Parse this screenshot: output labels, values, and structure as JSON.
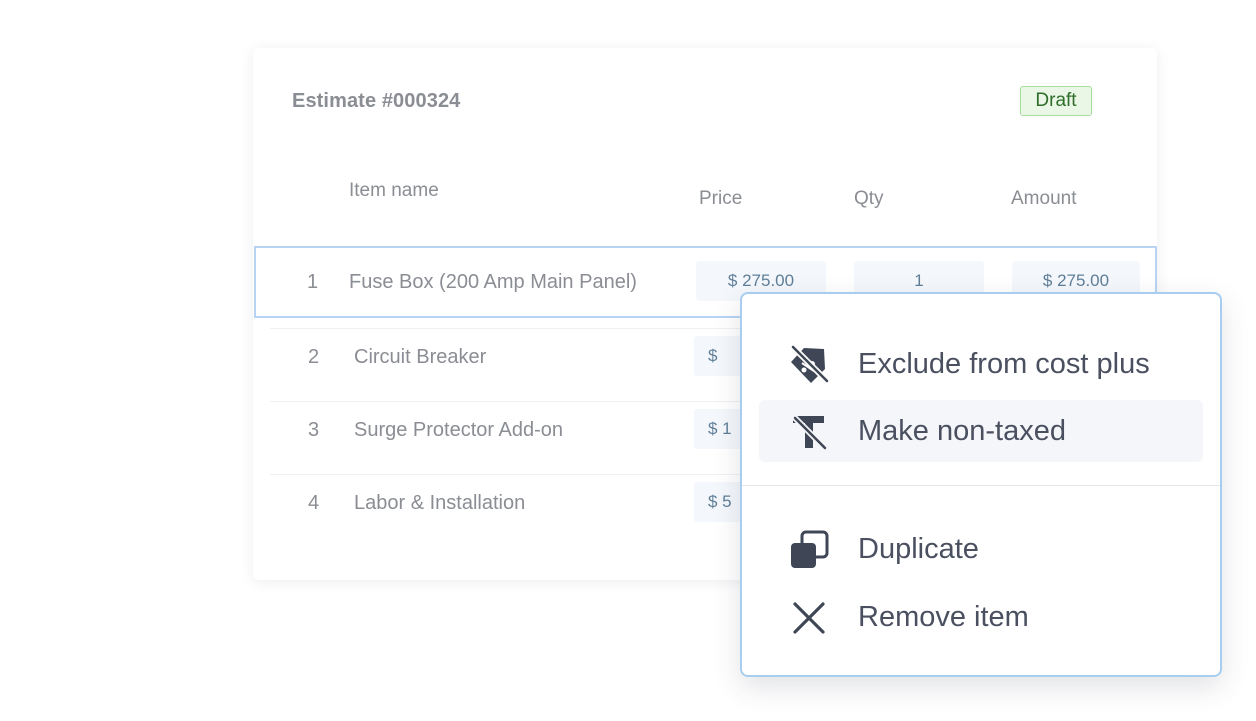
{
  "estimate": {
    "title": "Estimate #000324",
    "status": "Draft",
    "status_color": "#2f6e2a"
  },
  "columns": {
    "name": "Item name",
    "price": "Price",
    "qty": "Qty",
    "amount": "Amount"
  },
  "rows": [
    {
      "num": "1",
      "name": "Fuse Box (200 Amp Main Panel)",
      "price": "$ 275.00",
      "qty": "1",
      "amount": "$ 275.00"
    },
    {
      "num": "2",
      "name": "Circuit Breaker",
      "price": "$"
    },
    {
      "num": "3",
      "name": "Surge Protector Add-on",
      "price": "$ 1"
    },
    {
      "num": "4",
      "name": "Labor & Installation",
      "price": "$ 5"
    }
  ],
  "context_menu": {
    "items": [
      {
        "label": "Exclude from cost plus",
        "icon": "tag-slash-icon"
      },
      {
        "label": "Make non-taxed",
        "icon": "tax-off-icon"
      },
      {
        "label": "Duplicate",
        "icon": "duplicate-icon"
      },
      {
        "label": "Remove item",
        "icon": "close-icon"
      }
    ],
    "accent_color": "#a7cdf0",
    "icon_color": "#3f4756"
  }
}
